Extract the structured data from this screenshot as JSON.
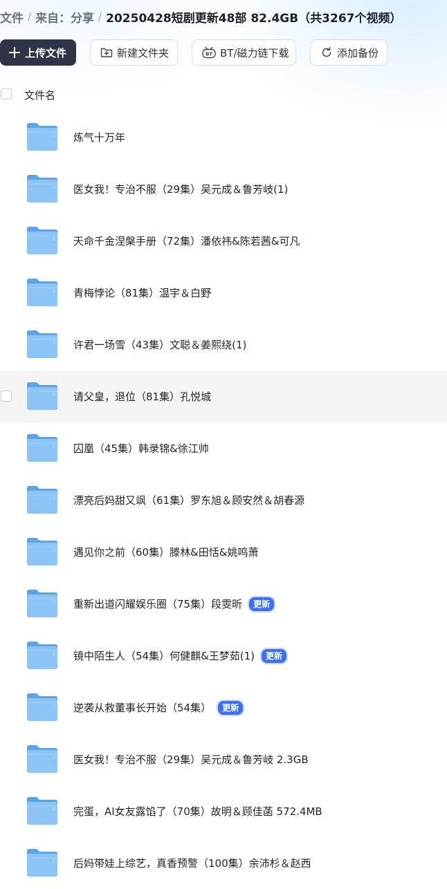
{
  "breadcrumb": {
    "root": "文件",
    "from": "来自：",
    "share": "分享",
    "sep": "/",
    "current": "20250428短剧更新48部 82.4GB（共3267个视频）"
  },
  "toolbar": {
    "upload_label": "上传文件",
    "new_folder_label": "新建文件夹",
    "bt_download_label": "BT/磁力链下载",
    "add_backup_label": "添加备份",
    "bt_icon_text": "BT"
  },
  "list": {
    "header_title": "文件名",
    "items": [
      {
        "name": "炼气十万年",
        "badge": ""
      },
      {
        "name": "医女我！专治不服（29集）吴元成＆鲁芳岐(1)",
        "badge": ""
      },
      {
        "name": "天命千金涅槃手册（72集）潘依祎&陈若茜&可凡",
        "badge": ""
      },
      {
        "name": "青梅悖论（81集）温宇＆白野",
        "badge": ""
      },
      {
        "name": "许君一场雪（43集）文聪＆姜熙绕(1)",
        "badge": ""
      },
      {
        "name": "请父皇，退位（81集）孔悦城",
        "badge": ""
      },
      {
        "name": "囚凰（45集）韩录锦&徐江帅",
        "badge": ""
      },
      {
        "name": "漂亮后妈甜又飒（61集）罗东旭＆顾安然＆胡春源",
        "badge": ""
      },
      {
        "name": "遇见你之前（60集）滕林&田恬&姚鸣萧",
        "badge": ""
      },
      {
        "name": "重新出道闪耀娱乐圈（75集）段雯昕",
        "badge": "更新"
      },
      {
        "name": "镜中陌生人（54集）何健麒&王梦茹(1)",
        "badge": "更新"
      },
      {
        "name": "逆袭从救董事长开始（54集）",
        "badge": "更新"
      },
      {
        "name": "医女我！专治不服（29集）吴元成＆鲁芳岐 2.3GB",
        "badge": ""
      },
      {
        "name": "完蛋，AI女友露馅了（70集）故明＆顾佳菡 572.4MB",
        "badge": ""
      },
      {
        "name": "后妈带娃上综艺，真香预警（100集）余沛杉＆赵西",
        "badge": ""
      }
    ]
  },
  "colors": {
    "primary_button": "#2f3447",
    "badge": "#3b6ff5",
    "folder": "#7ab8f5",
    "hover_row": "#f4f4f5"
  },
  "icons": {
    "upload": "plus-icon",
    "new_folder": "folder-plus-icon",
    "bt": "bt-icon",
    "backup": "refresh-icon",
    "folder": "folder-icon"
  }
}
